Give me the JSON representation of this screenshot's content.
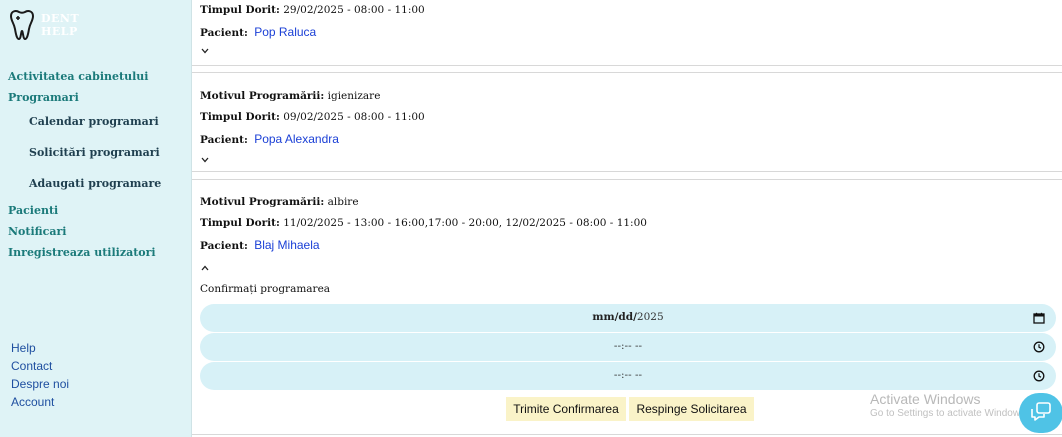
{
  "brand": {
    "name_line1": "DENT",
    "name_line2": "HELP",
    "logo_icon": "tooth-icon"
  },
  "sidebar": {
    "items": [
      {
        "label": "Activitatea cabinetului"
      },
      {
        "label": "Programari"
      },
      {
        "label": "Calendar programari"
      },
      {
        "label": "Solicitări programari"
      },
      {
        "label": "Adaugati programare"
      },
      {
        "label": "Pacienti"
      },
      {
        "label": "Notificari"
      },
      {
        "label": "Inregistreaza utilizatori"
      }
    ],
    "footer": [
      {
        "label": "Help"
      },
      {
        "label": "Contact"
      },
      {
        "label": "Despre noi"
      },
      {
        "label": "Account"
      }
    ]
  },
  "labels": {
    "reason": "Motivul Programării:",
    "time": "Timpul Dorit:",
    "patient": "Pacient:"
  },
  "requests": [
    {
      "reason": "",
      "time": "29/02/2025 - 08:00 - 11:00",
      "patient": "Pop Raluca",
      "expanded": false
    },
    {
      "reason": "igienizare",
      "time": "09/02/2025 - 08:00 - 11:00",
      "patient": "Popa Alexandra",
      "expanded": false
    },
    {
      "reason": "albire",
      "time": "11/02/2025 - 13:00 - 16:00,17:00 - 20:00, 12/02/2025 - 08:00 - 11:00",
      "patient": "Blaj Mihaela",
      "expanded": true
    }
  ],
  "confirm": {
    "label": "Confirmați programarea",
    "date_part_bold": "mm/dd/",
    "date_part_rest": "2025",
    "start_time": "--:-- --",
    "end_time": "--:-- --",
    "send_button": "Trimite Confirmarea",
    "reject_button": "Respinge Solicitarea"
  },
  "watermark": {
    "title": "Activate Windows",
    "subtitle": "Go to Settings to activate Windows."
  },
  "colors": {
    "sidebar_bg": "#dff3f6",
    "nav_accent": "#1b7a7a",
    "input_bg": "#d7f1f7",
    "button_bg": "#faf3c8",
    "patient_link": "#1a3fd6",
    "chat_bubble": "#4fc3e6"
  }
}
